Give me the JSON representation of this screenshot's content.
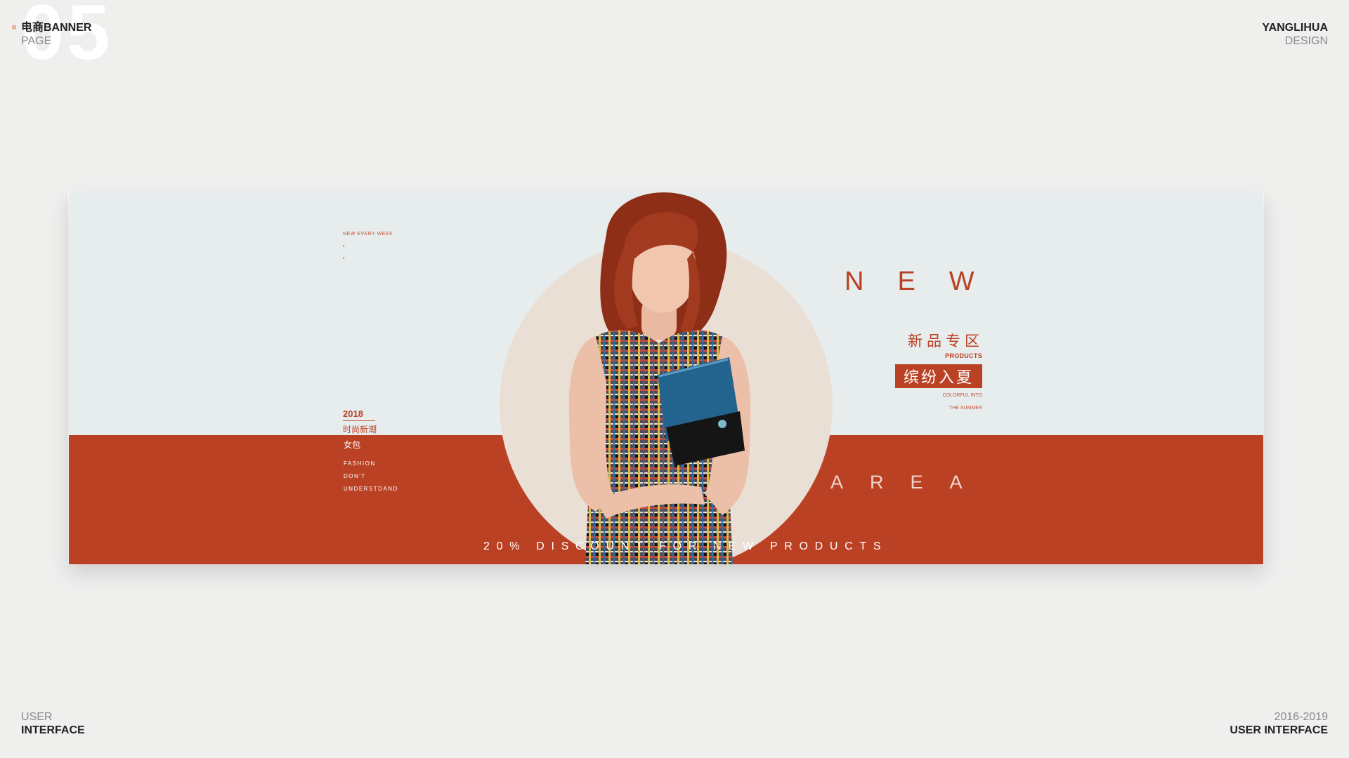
{
  "page": {
    "number": "05",
    "top_left": {
      "line1": "电商BANNER",
      "line2": "PAGE"
    },
    "top_right": {
      "line1": "YANGLIHUA",
      "line2": "DESIGN"
    },
    "bottom_left": {
      "line1": "USER",
      "line2": "INTERFACE"
    },
    "bottom_right": {
      "line1": "2016-2019",
      "line2": "USER INTERFACE"
    }
  },
  "banner": {
    "small_top": "NEW EVERY WEEK",
    "small_dot": "•",
    "year": "2018",
    "trend": "时尚新潮",
    "bag": "女包",
    "en_lines": [
      "FASHION",
      "DON'T",
      "UNDERSTDAND"
    ],
    "headline": "NEW",
    "subtitle_cn": "新品专区",
    "products": "PRODUCTS",
    "badge": "缤纷入夏",
    "colorful_lines": [
      "COLORFUL INTO",
      "THE SUMMER"
    ],
    "area": "AREA",
    "discount": "20% DISCOUNT FOR NEW PRODUCTS"
  },
  "colors": {
    "accent_red": "#bb4124",
    "banner_bg": "#e7eced",
    "circle": "#e9dfd5",
    "page_bg": "#efefee"
  }
}
